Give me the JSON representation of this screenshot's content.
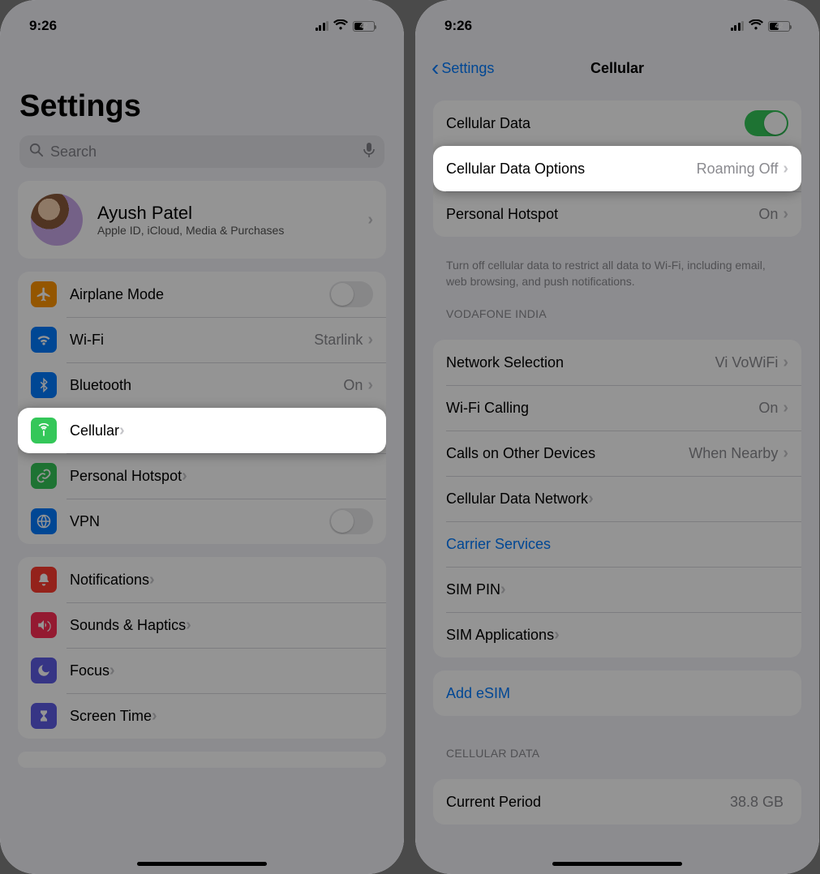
{
  "status": {
    "time": "9:26",
    "battery": "42"
  },
  "left": {
    "title": "Settings",
    "search_placeholder": "Search",
    "profile": {
      "name": "Ayush Patel",
      "desc": "Apple ID, iCloud, Media & Purchases"
    },
    "group1": [
      {
        "label": "Airplane Mode",
        "icon": "airplane",
        "color": "ic-orange",
        "trailing": "toggle-off"
      },
      {
        "label": "Wi-Fi",
        "icon": "wifi",
        "color": "ic-blue",
        "value": "Starlink",
        "trailing": "chev"
      },
      {
        "label": "Bluetooth",
        "icon": "bluetooth",
        "color": "ic-blue",
        "value": "On",
        "trailing": "chev"
      },
      {
        "label": "Cellular",
        "icon": "antenna",
        "color": "ic-green",
        "trailing": "chev",
        "highlight": true
      },
      {
        "label": "Personal Hotspot",
        "icon": "link",
        "color": "ic-green",
        "trailing": "chev"
      },
      {
        "label": "VPN",
        "icon": "globe",
        "color": "ic-blue",
        "trailing": "toggle-off"
      }
    ],
    "group2": [
      {
        "label": "Notifications",
        "icon": "bell",
        "color": "ic-red",
        "trailing": "chev"
      },
      {
        "label": "Sounds & Haptics",
        "icon": "speaker",
        "color": "ic-pink",
        "trailing": "chev"
      },
      {
        "label": "Focus",
        "icon": "moon",
        "color": "ic-indigo",
        "trailing": "chev"
      },
      {
        "label": "Screen Time",
        "icon": "hourglass",
        "color": "ic-indigo",
        "trailing": "chev"
      }
    ]
  },
  "right": {
    "back": "Settings",
    "title": "Cellular",
    "group_top": [
      {
        "label": "Cellular Data",
        "trailing": "toggle-on"
      },
      {
        "label": "Cellular Data Options",
        "value": "Roaming Off",
        "trailing": "chev",
        "highlight": true
      },
      {
        "label": "Personal Hotspot",
        "value": "On",
        "trailing": "chev"
      }
    ],
    "top_note": "Turn off cellular data to restrict all data to Wi-Fi, including email, web browsing, and push notifications.",
    "carrier_header": "VODAFONE INDIA",
    "group_carrier": [
      {
        "label": "Network Selection",
        "value": "Vi VoWiFi",
        "trailing": "chev"
      },
      {
        "label": "Wi-Fi Calling",
        "value": "On",
        "trailing": "chev"
      },
      {
        "label": "Calls on Other Devices",
        "value": "When Nearby",
        "trailing": "chev"
      },
      {
        "label": "Cellular Data Network",
        "trailing": "chev"
      },
      {
        "label": "Carrier Services",
        "link": true
      },
      {
        "label": "SIM PIN",
        "trailing": "chev"
      },
      {
        "label": "SIM Applications",
        "trailing": "chev"
      }
    ],
    "add_esim": "Add eSIM",
    "usage_header": "CELLULAR DATA",
    "usage": {
      "label": "Current Period",
      "value": "38.8 GB"
    }
  }
}
